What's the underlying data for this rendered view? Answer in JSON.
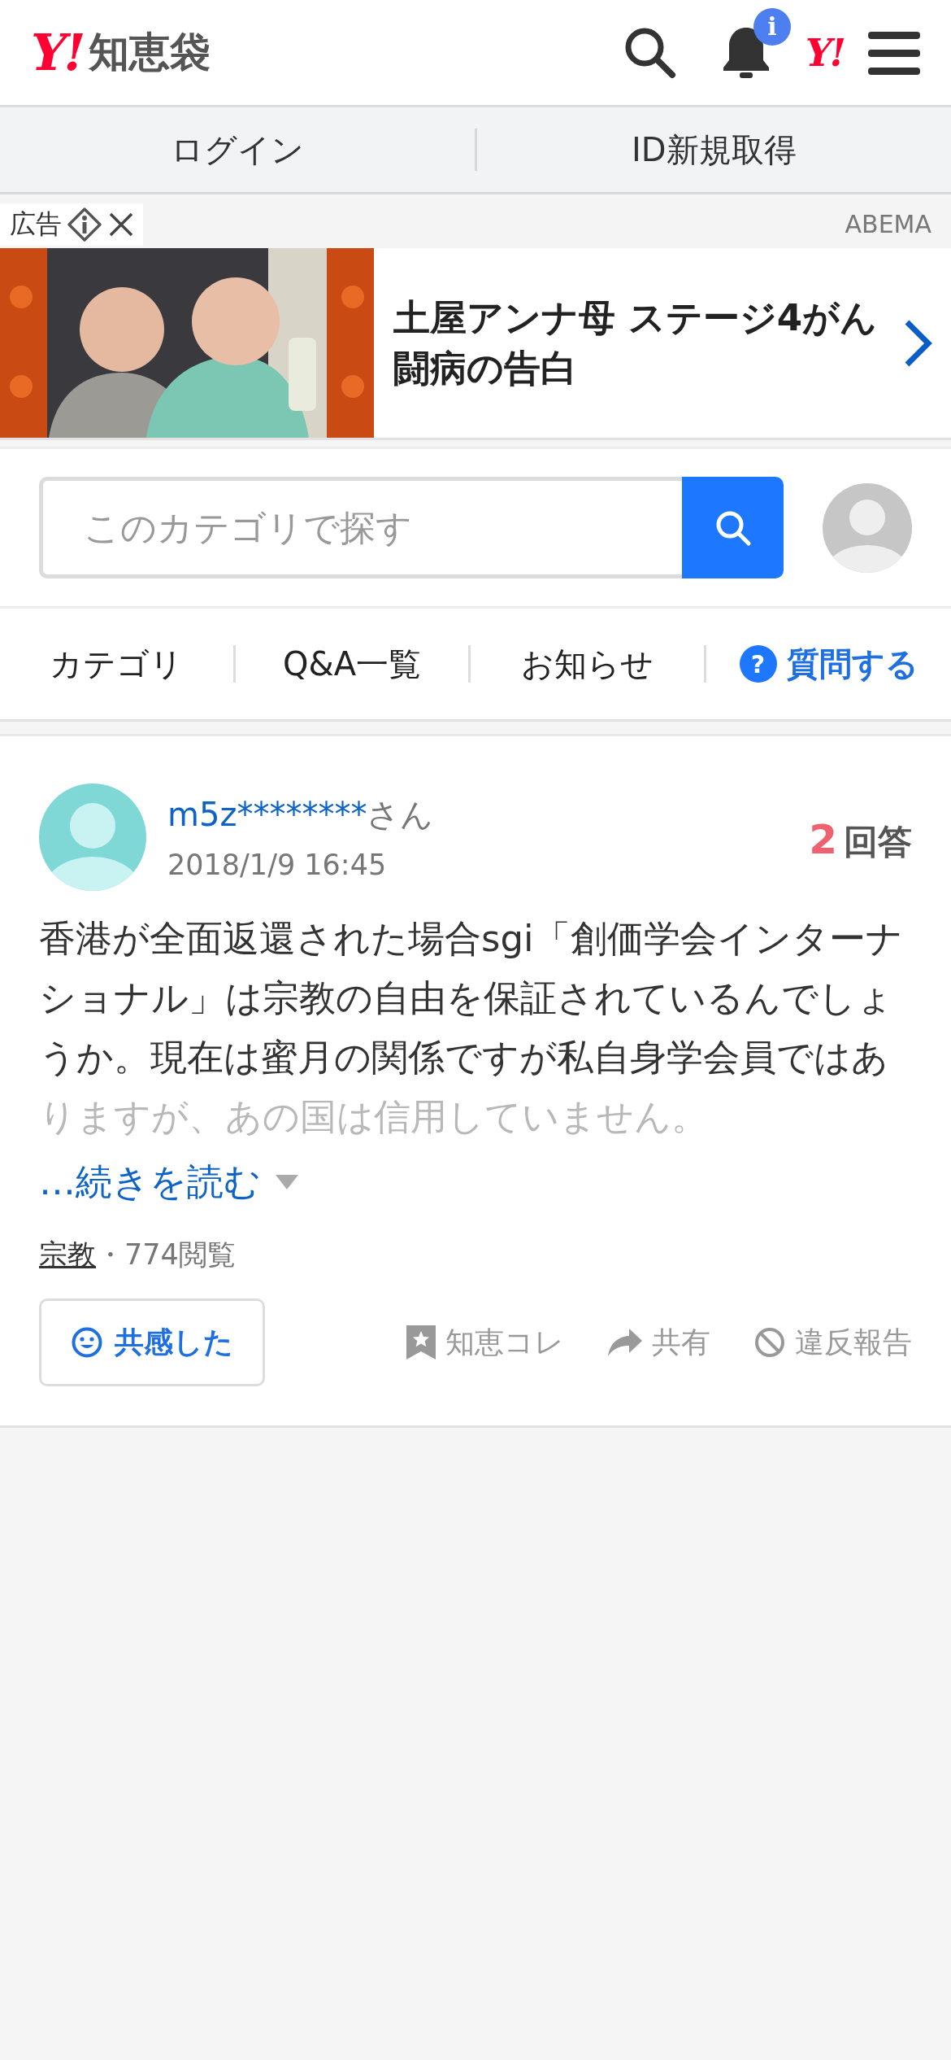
{
  "header": {
    "logo_mark": "Y!",
    "service_name": "知恵袋",
    "notification_badge": "i",
    "yahoo_link": "Y!"
  },
  "auth_links": [
    "ログイン",
    "ID新規取得"
  ],
  "ad": {
    "label": "広告",
    "advertiser": "ABEMA",
    "headline": "土屋アンナ母 ステージ4がん闘病の告白"
  },
  "search": {
    "placeholder": "このカテゴリで探す"
  },
  "nav": [
    {
      "label": "カテゴリ",
      "kind": "link"
    },
    {
      "label": "Q&A一覧",
      "kind": "link"
    },
    {
      "label": "お知らせ",
      "kind": "link"
    },
    {
      "label": "質問する",
      "kind": "action",
      "icon_text": "?"
    }
  ],
  "question": {
    "user": "m5z********",
    "honorific": "さん",
    "date": "2018/1/9 16:45",
    "answer_count": "2",
    "answer_label": "回答",
    "body": "香港が全面返還された場合sgi「創価学会インターナショナル」は宗教の自由を保証されているんでしょうか。現在は蜜月の関係ですが私自身学会員ではありますが、あの国は信用していません。",
    "read_more": "…続きを読む",
    "category": "宗教",
    "separator": "・",
    "views": "774閲覧",
    "empathy_button": "共感した",
    "actions": [
      {
        "label": "知恵コレ",
        "kind": "bookmark"
      },
      {
        "label": "共有",
        "kind": "share"
      },
      {
        "label": "違反報告",
        "kind": "report"
      }
    ]
  }
}
